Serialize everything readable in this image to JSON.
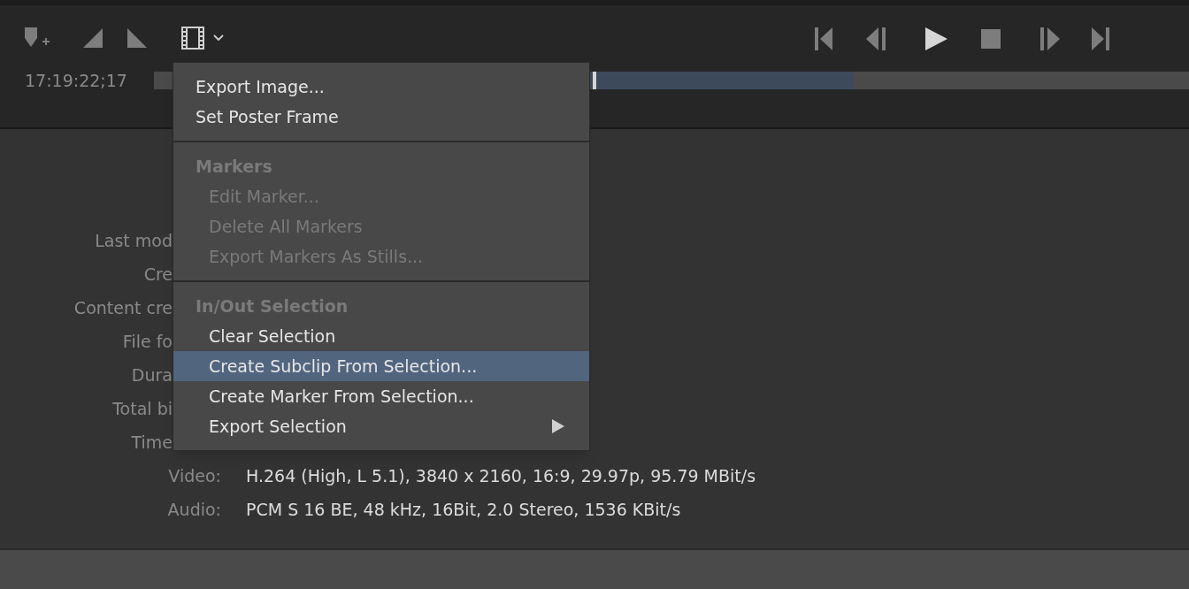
{
  "toolbar": {
    "timecode": "17:19:22;17",
    "playhead": {
      "level": 0.424
    }
  },
  "info_rows": [
    {
      "label": "Last mod",
      "cut_off": true
    },
    {
      "label": "Cre",
      "cut_off": true
    },
    {
      "label": "Content cre",
      "cut_off": true
    },
    {
      "label": "File fo",
      "cut_off": true
    },
    {
      "label": "Dura",
      "cut_off": true
    },
    {
      "label": "Total bi",
      "cut_off": true
    },
    {
      "label": "Time",
      "cut_off": true
    },
    {
      "label": "Video:",
      "cut_off": false,
      "value": "H.264 (High, L 5.1), 3840 x 2160, 16:9, 29.97p, 95.79 MBit/s"
    },
    {
      "label": "Audio:",
      "cut_off": false,
      "value": "PCM S 16 BE, 48 kHz, 16Bit, 2.0 Stereo, 1536 KBit/s"
    }
  ],
  "menu": {
    "sections": [
      {
        "items": [
          {
            "label": "Export Image...",
            "disabled": false,
            "selected": false,
            "submenu": false
          },
          {
            "label": "Set Poster Frame",
            "disabled": false,
            "selected": false,
            "submenu": false
          }
        ]
      },
      {
        "header": "Markers",
        "items": [
          {
            "label": "Edit Marker...",
            "disabled": true,
            "selected": false,
            "submenu": false
          },
          {
            "label": "Delete All Markers",
            "disabled": true,
            "selected": false,
            "submenu": false
          },
          {
            "label": "Export Markers As Stills...",
            "disabled": true,
            "selected": false,
            "submenu": false
          }
        ]
      },
      {
        "header": "In/Out Selection",
        "items": [
          {
            "label": "Clear Selection",
            "disabled": false,
            "selected": false,
            "submenu": false
          },
          {
            "label": "Create Subclip From Selection...",
            "disabled": false,
            "selected": true,
            "submenu": false
          },
          {
            "label": "Create Marker From Selection...",
            "disabled": false,
            "selected": false,
            "submenu": false
          },
          {
            "label": "Export Selection",
            "disabled": false,
            "selected": false,
            "submenu": true
          }
        ]
      }
    ]
  }
}
